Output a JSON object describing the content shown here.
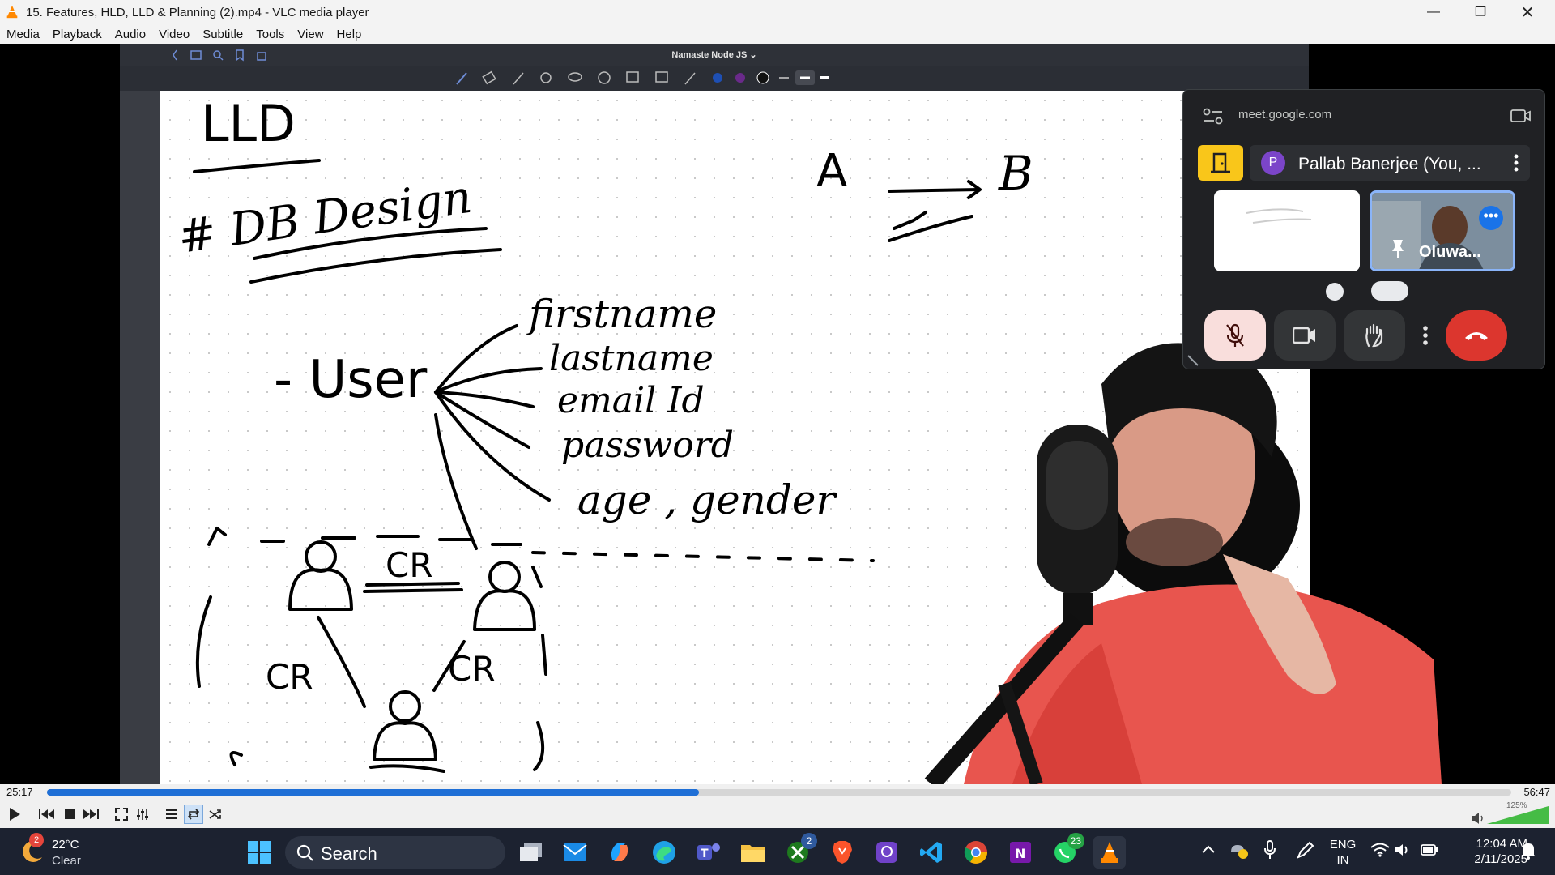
{
  "window": {
    "title": "15. Features, HLD, LLD & Planning (2).mp4 - VLC media player"
  },
  "menu": [
    "Media",
    "Playback",
    "Audio",
    "Video",
    "Subtitle",
    "Tools",
    "View",
    "Help"
  ],
  "video_app": {
    "title": "Namaste Node JS ⌄"
  },
  "whiteboard": {
    "heading": "LLD",
    "section": "# DB Design",
    "entity": "- User",
    "fields": [
      "firstname",
      "lastname",
      "email Id",
      "password",
      "age , gender"
    ],
    "relation_label": "CR",
    "arrow_left": "A",
    "arrow_right": "B"
  },
  "meet": {
    "url": "meet.google.com",
    "participant": "Pallab Banerjee (You, ...",
    "avatar_letter": "P",
    "tile_name": "Oluwa..."
  },
  "player": {
    "elapsed": "25:17",
    "duration": "56:47",
    "progress": 0.445,
    "volume": "125%"
  },
  "taskbar": {
    "weather_temp": "22°C",
    "weather_desc": "Clear",
    "weather_badge": "2",
    "search_placeholder": "Search",
    "xbox_badge": "2",
    "whatsapp_badge": "23",
    "lang_line1": "ENG",
    "lang_line2": "IN",
    "clock_time": "12:04 AM",
    "clock_date": "2/11/2025"
  }
}
